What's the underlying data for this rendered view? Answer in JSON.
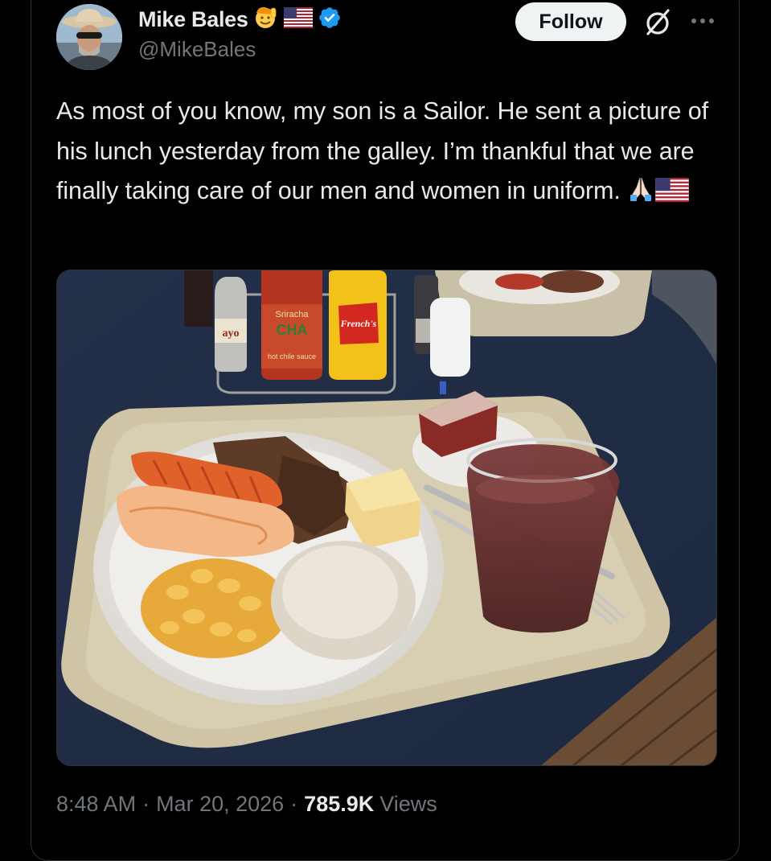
{
  "author": {
    "display_name": "Mike Bales",
    "handle": "@MikeBales",
    "badges": [
      "salute-emoji-icon",
      "us-flag-icon",
      "verified-badge-icon"
    ]
  },
  "actions": {
    "follow_label": "Follow",
    "grok_icon": "grok-icon",
    "more_icon": "more-options-icon"
  },
  "tweet": {
    "text": "As most of you know, my son is a Sailor. He sent a picture of his lunch yesterday from the galley. I’m thankful that we are finally taking care of our men and women in uniform.",
    "trailing_emojis": [
      "folded-hands-icon",
      "us-flag-icon"
    ]
  },
  "media": {
    "bottle_labels": {
      "hot_sauce_1": "ayo",
      "sriracha_top": "Sriracha",
      "sriracha_main": "CHA",
      "sriracha_sub": "hot chile sauce",
      "mustard": "French's"
    }
  },
  "meta": {
    "time": "8:48 AM",
    "separator": "·",
    "date": "Mar 20, 2026",
    "views_count": "785.9K",
    "views_label": "Views"
  },
  "colors": {
    "background": "#000000",
    "text_primary": "#e7e9ea",
    "text_secondary": "#71767b",
    "verified_blue": "#1d9bf0",
    "follow_bg": "#eff3f4"
  }
}
